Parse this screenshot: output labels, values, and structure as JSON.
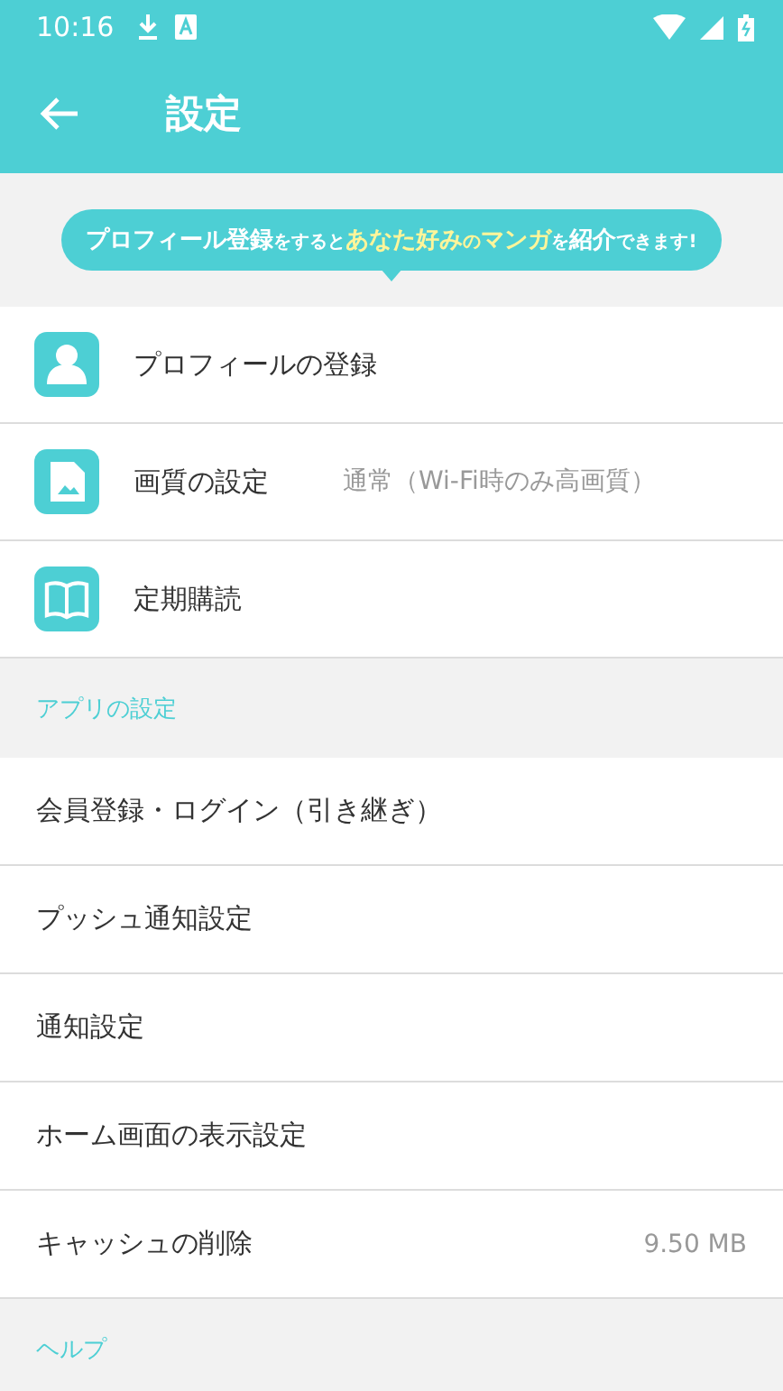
{
  "status_bar": {
    "time": "10:16"
  },
  "toolbar": {
    "title": "設定"
  },
  "banner": {
    "segments": [
      {
        "text": "プロフィール登録",
        "kind": "large",
        "highlight": false
      },
      {
        "text": "をすると",
        "kind": "small",
        "highlight": false
      },
      {
        "text": "あなた好み",
        "kind": "large",
        "highlight": true
      },
      {
        "text": "の",
        "kind": "small",
        "highlight": true
      },
      {
        "text": "マンガ",
        "kind": "large",
        "highlight": true
      },
      {
        "text": "を",
        "kind": "small",
        "highlight": false
      },
      {
        "text": "紹介",
        "kind": "large",
        "highlight": false
      },
      {
        "text": "できます!",
        "kind": "small",
        "highlight": false
      }
    ]
  },
  "icon_items": [
    {
      "kind": "person",
      "label": "プロフィールの登録"
    },
    {
      "kind": "image",
      "label": "画質の設定",
      "value": "通常（Wi-Fi時のみ高画質）"
    },
    {
      "kind": "book",
      "label": "定期購読"
    }
  ],
  "sections": [
    {
      "title": "アプリの設定",
      "items": [
        {
          "label": "会員登録・ログイン（引き継ぎ）"
        },
        {
          "label": "プッシュ通知設定"
        },
        {
          "label": "通知設定"
        },
        {
          "label": "ホーム画面の表示設定"
        },
        {
          "label": "キャッシュの削除",
          "value": "9.50 MB"
        }
      ]
    },
    {
      "title": "ヘルプ"
    }
  ]
}
